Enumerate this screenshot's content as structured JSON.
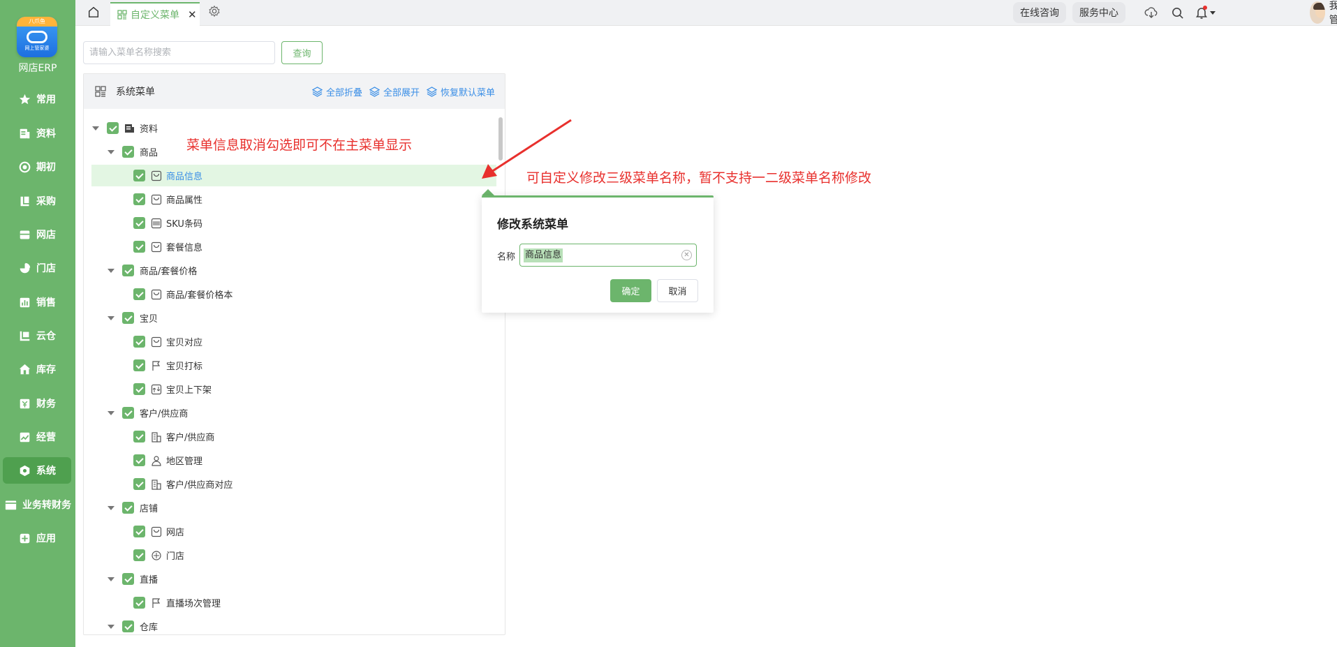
{
  "app": {
    "logo_top_text": "八爪鱼",
    "logo_bottom_text": "网上管家婆",
    "name": "网店ERP"
  },
  "sidebar": {
    "items": [
      {
        "label": "常用",
        "icon": "star-icon"
      },
      {
        "label": "资料",
        "icon": "document-icon"
      },
      {
        "label": "期初",
        "icon": "target-icon"
      },
      {
        "label": "采购",
        "icon": "book-icon"
      },
      {
        "label": "网店",
        "icon": "store-icon"
      },
      {
        "label": "门店",
        "icon": "pie-icon"
      },
      {
        "label": "销售",
        "icon": "chart-icon"
      },
      {
        "label": "云仓",
        "icon": "warehouse-icon"
      },
      {
        "label": "库存",
        "icon": "home-box-icon"
      },
      {
        "label": "财务",
        "icon": "finance-icon"
      },
      {
        "label": "经营",
        "icon": "trend-icon"
      },
      {
        "label": "系统",
        "icon": "hexagon-icon",
        "active": true
      },
      {
        "label": "业务转财务",
        "icon": "wallet-icon"
      },
      {
        "label": "应用",
        "icon": "plus-square-icon"
      }
    ]
  },
  "topbar": {
    "active_tab": "自定义菜单",
    "tab_close": "✕",
    "online_consult": "在线咨询",
    "service_center": "服务中心",
    "user_name": "我是管..."
  },
  "search": {
    "placeholder": "请输入菜单名称搜索",
    "value": "",
    "button": "查询"
  },
  "panel": {
    "title": "系统菜单",
    "collapse_all": "全部折叠",
    "expand_all": "全部展开",
    "restore_default": "恢复默认菜单"
  },
  "tree": [
    {
      "label": "资料",
      "level": 0,
      "icon": "document-icon"
    },
    {
      "label": "商品",
      "level": 1
    },
    {
      "label": "商品信息",
      "level": 2,
      "icon": "box-icon",
      "selected": true
    },
    {
      "label": "商品属性",
      "level": 2,
      "icon": "box-tag-icon"
    },
    {
      "label": "SKU条码",
      "level": 2,
      "icon": "barcode-icon"
    },
    {
      "label": "套餐信息",
      "level": 2,
      "icon": "package-icon"
    },
    {
      "label": "商品/套餐价格",
      "level": 1
    },
    {
      "label": "商品/套餐价格本",
      "level": 2,
      "icon": "price-book-icon"
    },
    {
      "label": "宝贝",
      "level": 1
    },
    {
      "label": "宝贝对应",
      "level": 2,
      "icon": "link-item-icon"
    },
    {
      "label": "宝贝打标",
      "level": 2,
      "icon": "flag-icon"
    },
    {
      "label": "宝贝上下架",
      "level": 2,
      "icon": "shelf-icon"
    },
    {
      "label": "客户/供应商",
      "level": 1
    },
    {
      "label": "客户/供应商",
      "level": 2,
      "icon": "building-icon"
    },
    {
      "label": "地区管理",
      "level": 2,
      "icon": "person-icon"
    },
    {
      "label": "客户/供应商对应",
      "level": 2,
      "icon": "building-icon"
    },
    {
      "label": "店铺",
      "level": 1
    },
    {
      "label": "网店",
      "level": 2,
      "icon": "online-store-icon"
    },
    {
      "label": "门店",
      "level": 2,
      "icon": "shop-icon"
    },
    {
      "label": "直播",
      "level": 1
    },
    {
      "label": "直播场次管理",
      "level": 2,
      "icon": "flag-icon"
    },
    {
      "label": "仓库",
      "level": 1
    }
  ],
  "annotations": {
    "uncheck_hint": "菜单信息取消勾选即可不在主菜单显示",
    "rename_hint": "可自定义修改三级菜单名称，暂不支持一二级菜单名称修改"
  },
  "popover": {
    "title": "修改系统菜单",
    "name_label": "名称",
    "name_value": "商品信息",
    "confirm": "确定",
    "cancel": "取消"
  },
  "colors": {
    "sidebar_green": "#6cb56c",
    "link_blue": "#3a8ee6",
    "annotation_red": "#e8302d"
  }
}
